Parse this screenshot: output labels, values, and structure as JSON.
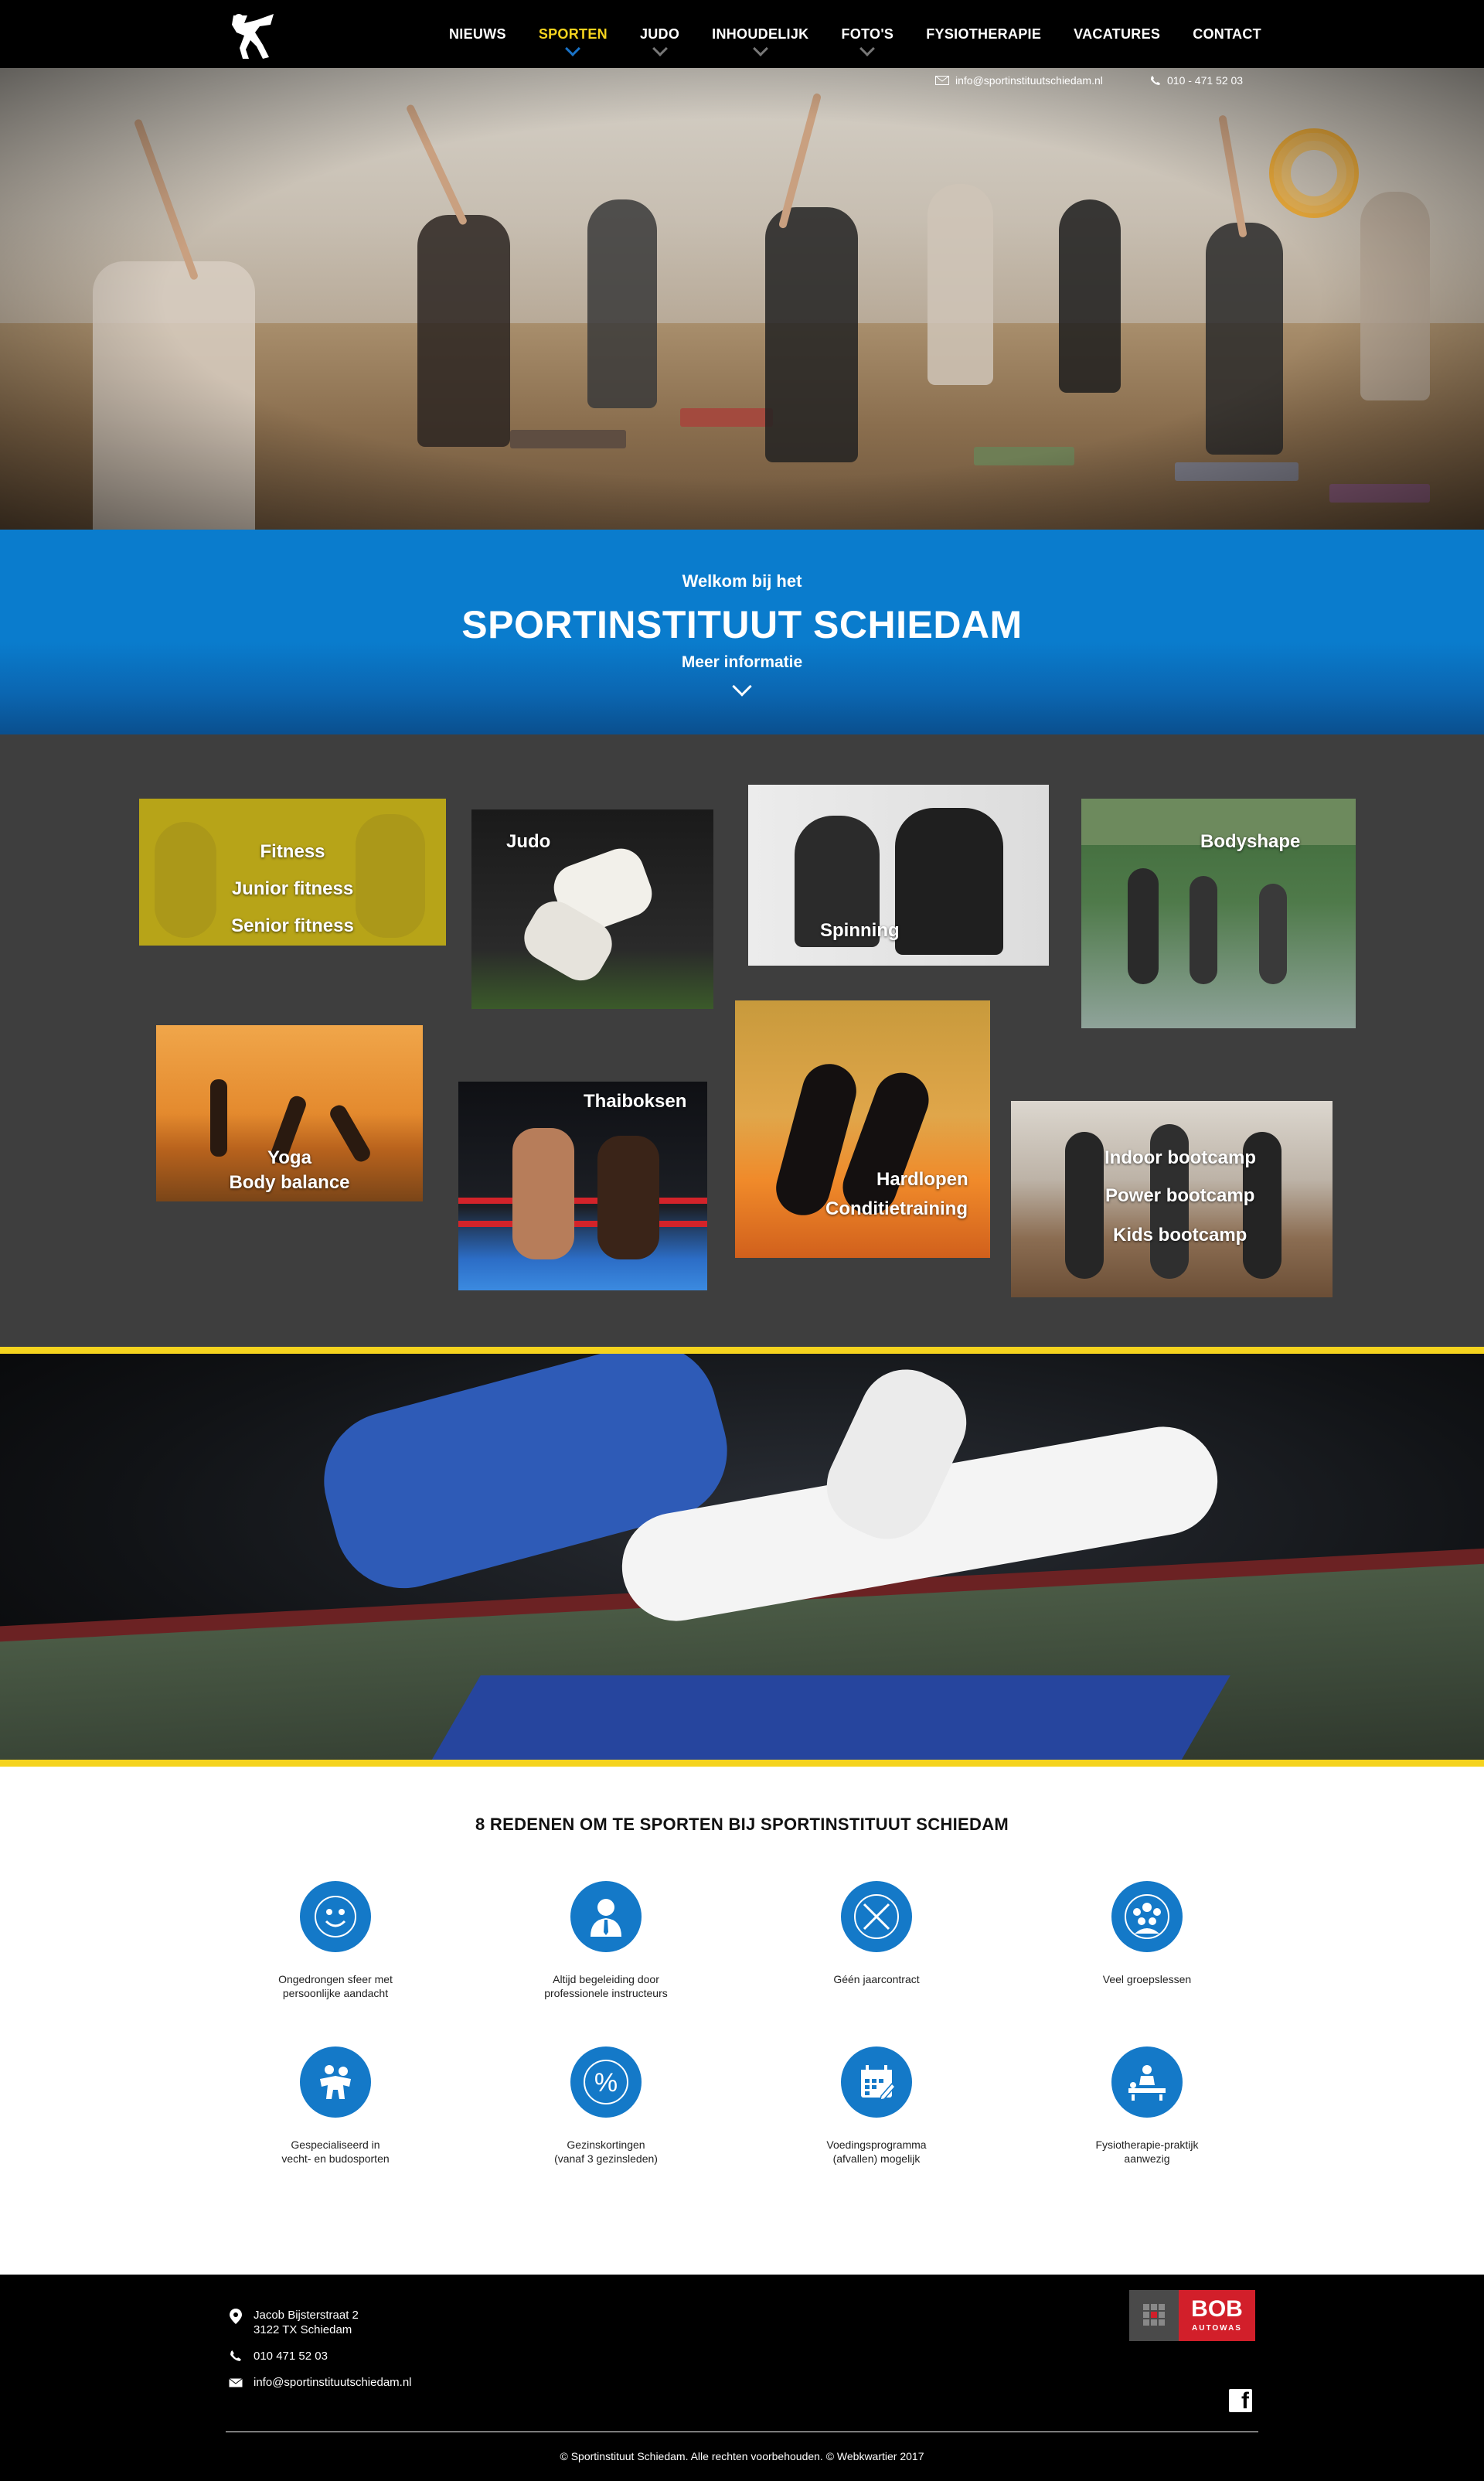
{
  "nav": {
    "items": [
      {
        "label": "NIEUWS",
        "active": false,
        "dropdown": false
      },
      {
        "label": "SPORTEN",
        "active": true,
        "dropdown": true
      },
      {
        "label": "JUDO",
        "active": false,
        "dropdown": true
      },
      {
        "label": "INHOUDELIJK",
        "active": false,
        "dropdown": true
      },
      {
        "label": "FOTO'S",
        "active": false,
        "dropdown": true
      },
      {
        "label": "FYSIOTHERAPIE",
        "active": false,
        "dropdown": false
      },
      {
        "label": "VACATURES",
        "active": false,
        "dropdown": false
      },
      {
        "label": "CONTACT",
        "active": false,
        "dropdown": false
      }
    ],
    "active_color": "#f5d31e"
  },
  "contact_top": {
    "email": "info@sportinstituutschiedam.nl",
    "phone": "010 - 471 52 03"
  },
  "welcome": {
    "pre": "Welkom bij het",
    "title": "SPORTINSTITUUT SCHIEDAM",
    "more": "Meer informatie"
  },
  "sports": {
    "fitness": [
      "Fitness",
      "Junior fitness",
      "Senior fitness"
    ],
    "judo": "Judo",
    "spinning": "Spinning",
    "bodyshape": "Bodyshape",
    "yoga": [
      "Yoga",
      "Body balance"
    ],
    "thaiboksen": "Thaiboksen",
    "hardlopen": [
      "Hardlopen",
      "Conditietraining"
    ],
    "bootcamp": [
      "Indoor bootcamp",
      "Power bootcamp",
      "Kids bootcamp"
    ]
  },
  "reasons": {
    "title": "8 REDENEN OM TE SPORTEN BIJ SPORTINSTITUUT SCHIEDAM",
    "items": [
      {
        "icon": "smiley-icon",
        "text1": "Ongedrongen sfeer met",
        "text2": "persoonlijke aandacht"
      },
      {
        "icon": "instructor-icon",
        "text1": "Altijd begeleiding door",
        "text2": "professionele instructeurs"
      },
      {
        "icon": "no-contract-icon",
        "text1": "Géén jaarcontract",
        "text2": ""
      },
      {
        "icon": "group-icon",
        "text1": "Veel groepslessen",
        "text2": ""
      },
      {
        "icon": "wrestling-icon",
        "text1": "Gespecialiseerd in",
        "text2": "vecht- en budosporten"
      },
      {
        "icon": "percent-icon",
        "text1": "Gezinskortingen",
        "text2": "(vanaf 3 gezinsleden)"
      },
      {
        "icon": "calendar-icon",
        "text1": "Voedingsprogramma",
        "text2": "(afvallen) mogelijk"
      },
      {
        "icon": "physio-icon",
        "text1": "Fysiotherapie-praktijk",
        "text2": "aanwezig"
      }
    ],
    "accent": "#1479c8"
  },
  "footer": {
    "address1": "Jacob Bijsterstraat 2",
    "address2": "3122 TX Schiedam",
    "phone": "010 471 52 03",
    "email": "info@sportinstituutschiedam.nl",
    "bob_big": "BOB",
    "bob_small": "AUTOWAS",
    "copyright": "© Sportinstituut Schiedam. Alle rechten voorbehouden. © Webkwartier 2017"
  }
}
